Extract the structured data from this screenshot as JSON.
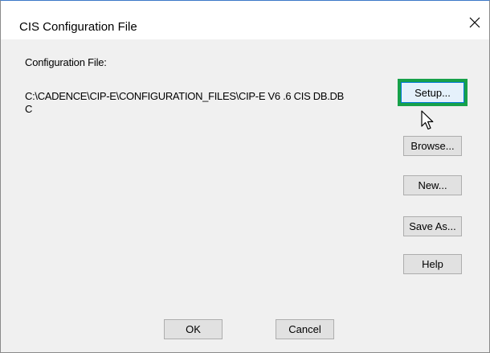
{
  "window": {
    "title": "CIS Configuration File",
    "close_glyph": "close-icon"
  },
  "content": {
    "config_label": "Configuration File:",
    "config_path": "C:\\CADENCE\\CIP-E\\CONFIGURATION_FILES\\CIP-E V6 .6 CIS DB.DBC"
  },
  "buttons": {
    "setup": "Setup...",
    "browse": "Browse...",
    "new": "New...",
    "save_as": "Save As...",
    "help": "Help",
    "ok": "OK",
    "cancel": "Cancel"
  },
  "colors": {
    "focus_highlight": "#17a14a",
    "title_accent": "#3c78c8",
    "button_face": "#e1e1e1",
    "dialog_bg": "#f0f0f0"
  },
  "icons": {
    "cursor": "arrow-cursor-icon"
  }
}
